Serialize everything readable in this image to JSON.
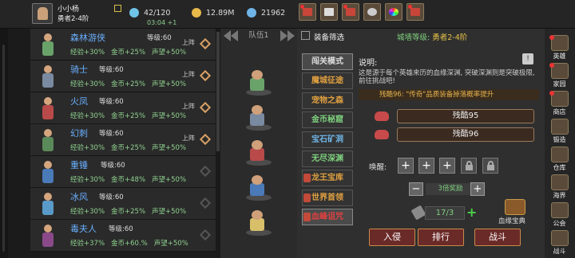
{
  "player": {
    "name": "小小杨",
    "title": "勇者2-4阶",
    "time": "03:04 +1"
  },
  "resources": [
    {
      "value": "42/120",
      "color": "#6fc3e8"
    },
    {
      "value": "12.89M",
      "color": "#e6b94a"
    },
    {
      "value": "21962",
      "color": "#6fb4e6"
    }
  ],
  "top_buttons": [
    "shop-icon",
    "mail-icon",
    "gift-icon",
    "settings-icon",
    "color-wheel-icon",
    "event-icon"
  ],
  "team": {
    "label": "队伍1"
  },
  "heroes": [
    {
      "name": "森林游侠",
      "level": "等级:60",
      "status": "上阵",
      "exp": "经验+30%",
      "gold": "金币+25%",
      "fame": "声望+50%",
      "body": "#6aa36a",
      "diamond": "#d8a064"
    },
    {
      "name": "骑士",
      "level": "等级:60",
      "status": "上阵",
      "exp": "经验+30%",
      "gold": "金币+25%",
      "fame": "声望+50%",
      "body": "#7a8aa0",
      "diamond": "#d8a064"
    },
    {
      "name": "火凤",
      "level": "等级:60",
      "status": "上阵",
      "exp": "经验+30%",
      "gold": "金币+25%",
      "fame": "声望+50%",
      "body": "#b84a4a",
      "diamond": "#d8a064"
    },
    {
      "name": "幻刺",
      "level": "等级:60",
      "status": "上阵",
      "exp": "经验+30%",
      "gold": "金币+25%",
      "fame": "声望+50%",
      "body": "#5a8a5a",
      "diamond": "#d8a064"
    },
    {
      "name": "重锤",
      "level": "等级:60",
      "status": "",
      "exp": "经验+30%",
      "gold": "金币+48%",
      "fame": "声望+50%",
      "body": "#4a7ab8",
      "diamond": "#555555"
    },
    {
      "name": "冰风",
      "level": "等级:60",
      "status": "",
      "exp": "经验+30%",
      "gold": "金币+25%",
      "fame": "声望+50%",
      "body": "#5a9ac8",
      "diamond": "#555555"
    },
    {
      "name": "毒夫人",
      "level": "等级:60",
      "status": "",
      "exp": "经验+37%",
      "gold": "金币+60.%",
      "fame": "声望+50%",
      "body": "#8a4a8a",
      "diamond": "#555555"
    }
  ],
  "team_slots": [
    {
      "body": "#6aa36a"
    },
    {
      "body": "#7a8aa0"
    },
    {
      "body": "#b84a4a"
    },
    {
      "body": "#4a7ab8"
    },
    {
      "body": "#d8c06a"
    }
  ],
  "filter": {
    "label": "装备筛选"
  },
  "wall": {
    "label": "城墙等级:",
    "value": "勇者2-4阶"
  },
  "modes": [
    {
      "label": "闯关模式",
      "color": "#ddd",
      "locked": false,
      "selected": true
    },
    {
      "label": "魔城征途",
      "color": "#e0a040",
      "locked": false,
      "selected": false
    },
    {
      "label": "宠物之森",
      "color": "#e0a040",
      "locked": false,
      "selected": false
    },
    {
      "label": "金币秘窟",
      "color": "#7fd17f",
      "locked": false,
      "selected": false
    },
    {
      "label": "宝石矿洞",
      "color": "#6fb4e6",
      "locked": false,
      "selected": false
    },
    {
      "label": "无尽深渊",
      "color": "#7fd17f",
      "locked": false,
      "selected": false
    },
    {
      "label": "龙王宝库",
      "color": "#e0a040",
      "locked": true,
      "selected": false
    },
    {
      "label": "世界首领",
      "color": "#e0a040",
      "locked": true,
      "selected": false
    },
    {
      "label": "血峰诅咒",
      "color": "#e04040",
      "locked": true,
      "selected": true
    }
  ],
  "description": {
    "label": "说明:",
    "text": "这是源于每个英雄来历的血缘深渊, 突破深渊则是突破极限, 前往挑战吧!"
  },
  "banner": "残酷96: \"传奇\"品质装备掉落概率提升",
  "difficulties": [
    "残酷95",
    "残酷96"
  ],
  "wake": {
    "label": "唤醒:"
  },
  "multiplier": {
    "label": "3倍奖励"
  },
  "counter": {
    "value": "17/3"
  },
  "chest": {
    "label": "血缘宝典"
  },
  "actions": [
    "入侵",
    "排行",
    "战斗"
  ],
  "sidebar": [
    {
      "label": "英雄",
      "icon": "hero-icon",
      "badge": true
    },
    {
      "label": "家园",
      "icon": "home-icon",
      "badge": true
    },
    {
      "label": "商店",
      "icon": "shop-icon",
      "badge": true
    },
    {
      "label": "锻造",
      "icon": "anvil-icon",
      "badge": false
    },
    {
      "label": "仓库",
      "icon": "warehouse-icon",
      "badge": false
    },
    {
      "label": "海界",
      "icon": "sea-icon",
      "badge": false
    },
    {
      "label": "公会",
      "icon": "guild-icon",
      "badge": false
    },
    {
      "label": "战斗",
      "icon": "battle-icon",
      "badge": false
    }
  ]
}
